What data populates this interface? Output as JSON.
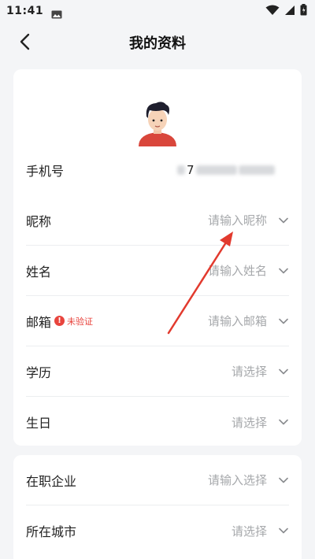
{
  "status_bar": {
    "time": "11:41"
  },
  "header": {
    "title": "我的资料"
  },
  "profile": {
    "phone": {
      "label": "手机号",
      "value_visible": "7"
    },
    "nickname": {
      "label": "昵称",
      "placeholder": "请输入昵称"
    },
    "name": {
      "label": "姓名",
      "placeholder": "请输入姓名"
    },
    "email": {
      "label": "邮箱",
      "badge": "未验证",
      "placeholder": "请输入邮箱"
    },
    "education": {
      "label": "学历",
      "placeholder": "请选择"
    },
    "birthday": {
      "label": "生日",
      "placeholder": "请选择"
    }
  },
  "work": {
    "company": {
      "label": "在职企业",
      "placeholder": "请输入选择"
    },
    "city": {
      "label": "所在城市",
      "placeholder": "请选择"
    }
  },
  "colors": {
    "accent_red": "#e8443d",
    "background": "#f4f5f7",
    "placeholder_gray": "#a6a8ab"
  },
  "icons": [
    "image-icon",
    "wifi-icon",
    "signal-icon",
    "battery-icon",
    "back-arrow-icon",
    "chevron-down-icon",
    "warning-icon",
    "avatar-illustration"
  ]
}
